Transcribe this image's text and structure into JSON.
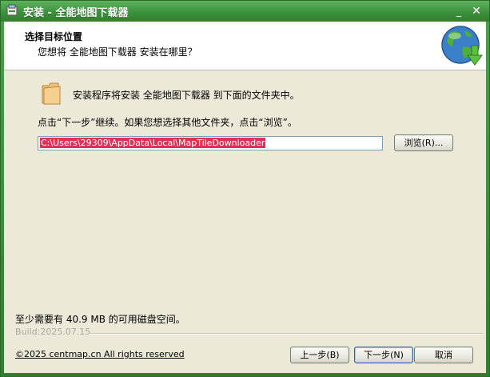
{
  "window": {
    "title": "安装 - 全能地图下载器",
    "minimize_glyph": "_",
    "close_glyph": "✕"
  },
  "header": {
    "title": "选择目标位置",
    "subtitle": "您想将 全能地图下载器 安装在哪里？",
    "icon": "globe-download-icon"
  },
  "content": {
    "info": "安装程序将安装 全能地图下载器 到下面的文件夹中。",
    "instructions": "点击“下一步”继续。如果您想选择其他文件夹，点击“浏览”。",
    "path_value": "C:\\Users\\29309\\AppData\\Local\\MapTileDownloader",
    "browse_label": "浏览(R)...",
    "disk_space": "至少需要有 40.9 MB 的可用磁盘空间。"
  },
  "footer": {
    "build": "Build:2025.07.15",
    "copyright": "©2025 centmap.cn All rights reserved",
    "back_label": "上一步(B)",
    "next_label": "下一步(N)",
    "cancel_label": "取消"
  },
  "colors": {
    "titlebar": "#3a8f3a",
    "selection": "#e0305a",
    "panel": "#ece9d8"
  }
}
